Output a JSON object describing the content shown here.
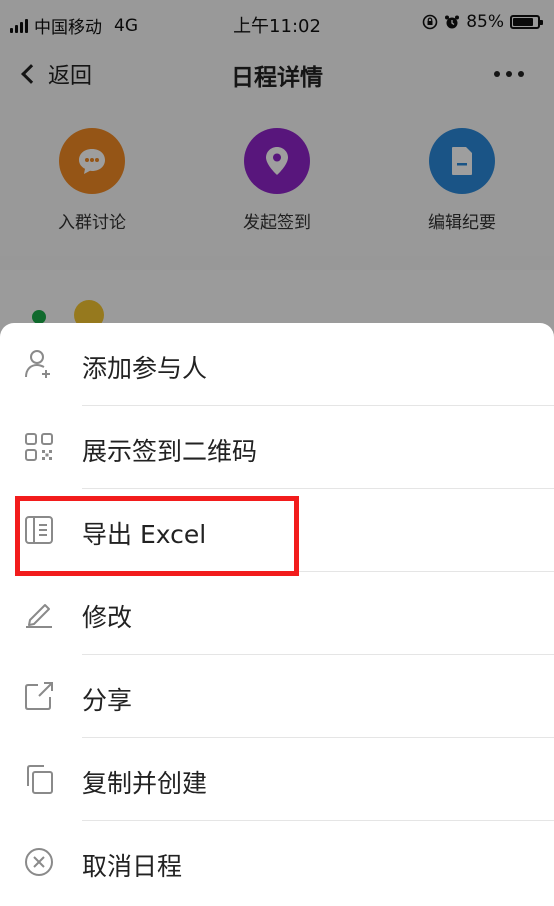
{
  "status_bar": {
    "carrier": "中国移动",
    "network": "4G",
    "time": "上午11:02",
    "battery": "85%",
    "battery_level": 0.85
  },
  "nav": {
    "back_label": "返回",
    "title": "日程详情"
  },
  "actions": [
    {
      "label": "入群讨论",
      "icon": "chat-bubble-icon",
      "color": "#f08a24"
    },
    {
      "label": "发起签到",
      "icon": "location-pin-icon",
      "color": "#8e24c8"
    },
    {
      "label": "编辑纪要",
      "icon": "document-icon",
      "color": "#2b88d8"
    }
  ],
  "menu": {
    "items": [
      {
        "label": "添加参与人",
        "icon": "add-person-icon"
      },
      {
        "label": "展示签到二维码",
        "icon": "qr-code-icon"
      },
      {
        "label": "导出 Excel",
        "icon": "export-excel-icon"
      },
      {
        "label": "修改",
        "icon": "edit-pen-icon"
      },
      {
        "label": "分享",
        "icon": "share-icon"
      },
      {
        "label": "复制并创建",
        "icon": "copy-icon"
      },
      {
        "label": "取消日程",
        "icon": "cancel-circle-icon"
      }
    ]
  },
  "colors": {
    "highlight": "#f21c1c",
    "icon_gray": "#8a8a8a"
  }
}
